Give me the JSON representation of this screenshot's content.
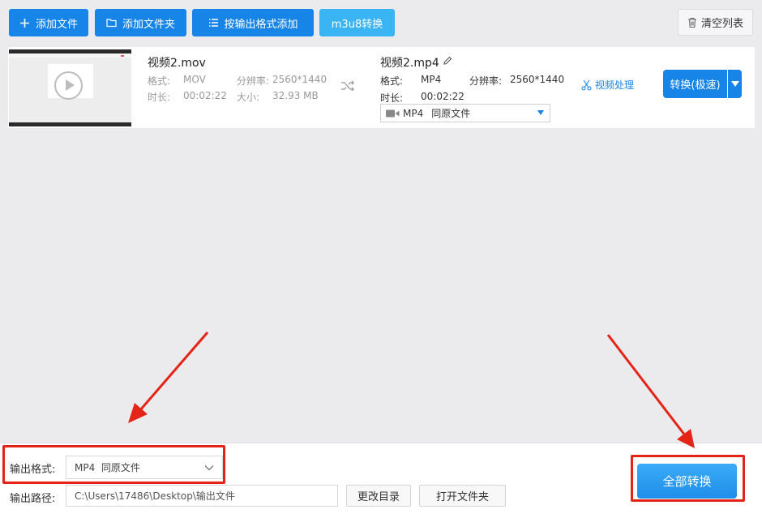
{
  "toolbar": {
    "add_file": "添加文件",
    "add_folder": "添加文件夹",
    "add_by_format": "按输出格式添加",
    "m3u8": "m3u8转换",
    "clear_list": "清空列表"
  },
  "file": {
    "source": {
      "name": "视频2.mov",
      "format_label": "格式:",
      "format": "MOV",
      "resolution_label": "分辨率:",
      "resolution": "2560*1440",
      "duration_label": "时长:",
      "duration": "00:02:22",
      "size_label": "大小:",
      "size": "32.93 MB"
    },
    "target": {
      "name": "视频2.mp4",
      "format_label": "格式:",
      "format": "MP4",
      "resolution_label": "分辨率:",
      "resolution": "2560*1440",
      "duration_label": "时长:",
      "duration": "00:02:22",
      "select_format": "MP4",
      "select_quality": "同原文件"
    },
    "edit_label": "视频处理",
    "convert_label": "转换(极速)"
  },
  "bottom": {
    "output_format_label": "输出格式:",
    "output_format_value": "MP4  同原文件",
    "output_path_label": "输出路径:",
    "output_path_value": "C:\\Users\\17486\\Desktop\\输出文件",
    "change_dir": "更改目录",
    "open_folder": "打开文件夹",
    "convert_all": "全部转换"
  },
  "colors": {
    "primary": "#1785e8",
    "light_primary": "#3ab4f2",
    "annotation_red": "#e52418",
    "background": "#ebebee"
  }
}
